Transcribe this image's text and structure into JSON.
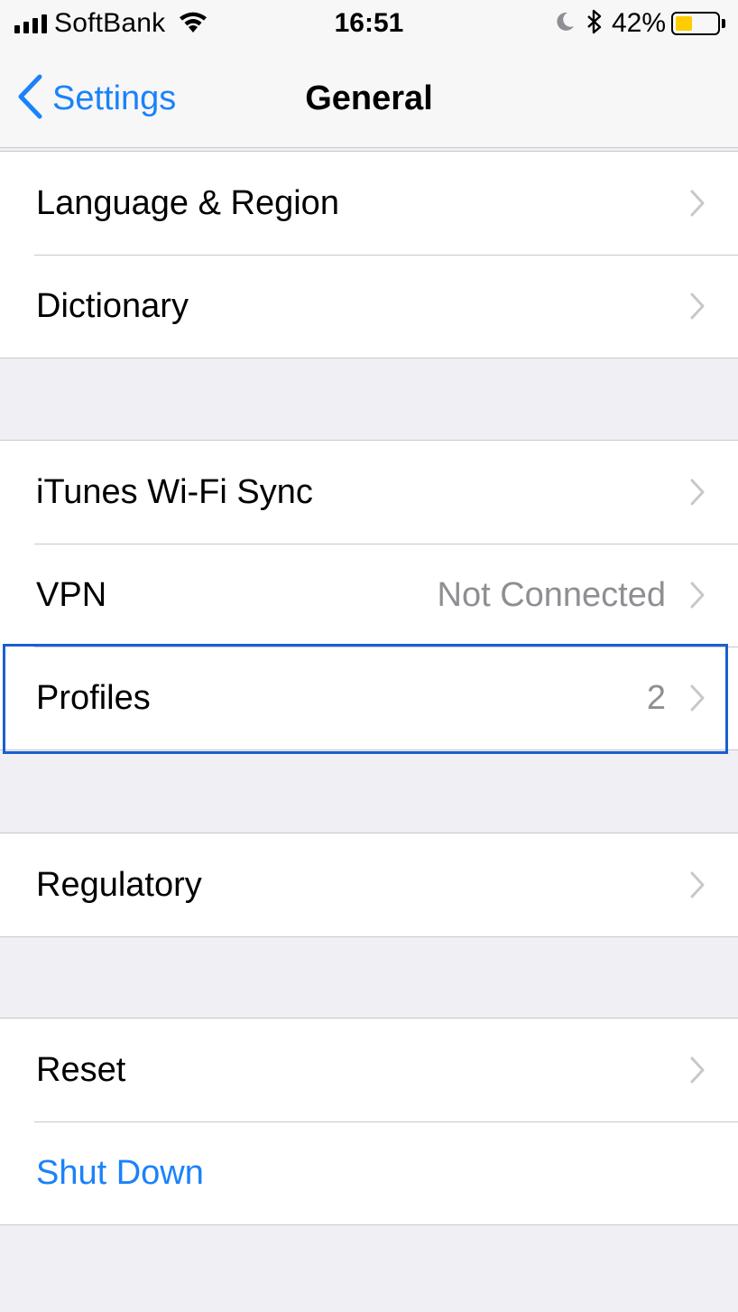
{
  "status_bar": {
    "carrier": "SoftBank",
    "time": "16:51",
    "battery_percent": "42%",
    "icons": [
      "signal-bars-icon",
      "wifi-icon",
      "moon-icon",
      "bluetooth-icon",
      "battery-icon"
    ],
    "battery_level": 0.42,
    "battery_color": "#fecc02"
  },
  "nav": {
    "back_label": "Settings",
    "title": "General"
  },
  "groups": [
    {
      "rows": [
        {
          "label": "Language & Region",
          "value": ""
        },
        {
          "label": "Dictionary",
          "value": ""
        }
      ]
    },
    {
      "rows": [
        {
          "label": "iTunes Wi-Fi Sync",
          "value": ""
        },
        {
          "label": "VPN",
          "value": "Not Connected"
        },
        {
          "label": "Profiles",
          "value": "2"
        }
      ]
    },
    {
      "rows": [
        {
          "label": "Regulatory",
          "value": ""
        }
      ]
    },
    {
      "rows": [
        {
          "label": "Reset",
          "value": ""
        },
        {
          "label": "Shut Down",
          "value": ""
        }
      ]
    }
  ],
  "colors": {
    "accent": "#1a82fb",
    "highlight": "#1a5fd0",
    "background": "#efeff4"
  }
}
